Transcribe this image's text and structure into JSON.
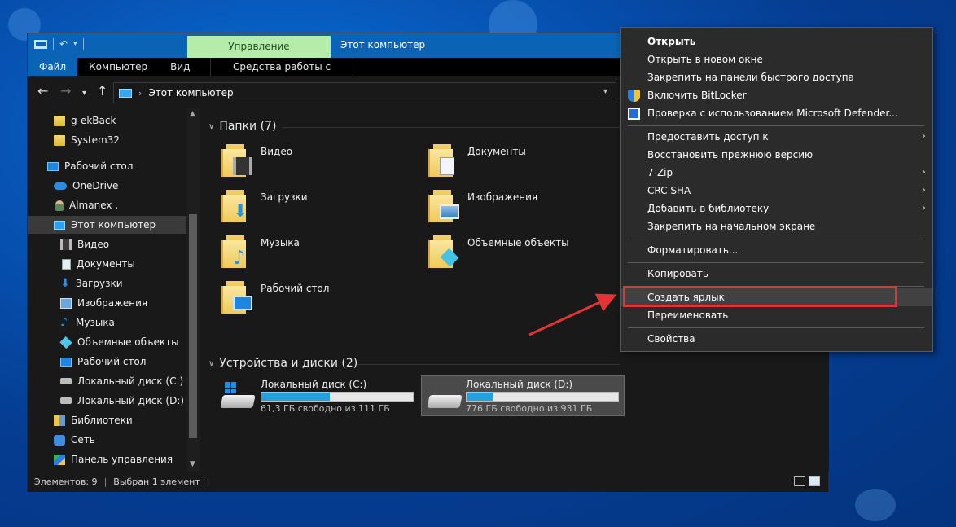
{
  "titlebar": {
    "manage_tab": "Управление",
    "window_title": "Этот компьютер"
  },
  "ribbon": {
    "tabs": [
      "Файл",
      "Компьютер",
      "Вид"
    ],
    "manage_subtab": "Средства работы с дисками"
  },
  "address": {
    "crumb": "Этот компьютер"
  },
  "sidebar": {
    "items": [
      {
        "label": "g-ekBack",
        "icon": "folder-icon"
      },
      {
        "label": "System32",
        "icon": "folder-icon"
      },
      {
        "label": "Рабочий стол",
        "icon": "desktop-icon"
      },
      {
        "label": "OneDrive",
        "icon": "cloud-icon"
      },
      {
        "label": "Almanex .",
        "icon": "user-icon"
      },
      {
        "label": "Этот компьютер",
        "icon": "computer-icon",
        "selected": true
      },
      {
        "label": "Видео",
        "icon": "video-icon"
      },
      {
        "label": "Документы",
        "icon": "documents-icon"
      },
      {
        "label": "Загрузки",
        "icon": "downloads-icon"
      },
      {
        "label": "Изображения",
        "icon": "pictures-icon"
      },
      {
        "label": "Музыка",
        "icon": "music-icon"
      },
      {
        "label": "Объемные объекты",
        "icon": "3d-objects-icon"
      },
      {
        "label": "Рабочий стол",
        "icon": "desktop-icon"
      },
      {
        "label": "Локальный диск (C:)",
        "icon": "drive-icon"
      },
      {
        "label": "Локальный диск (D:)",
        "icon": "drive-icon"
      },
      {
        "label": "Библиотеки",
        "icon": "libraries-icon"
      },
      {
        "label": "Сеть",
        "icon": "network-icon"
      },
      {
        "label": "Панель управления",
        "icon": "control-panel-icon"
      }
    ]
  },
  "content": {
    "folders_header": "Папки (7)",
    "folders": [
      "Видео",
      "Документы",
      "Загрузки",
      "Изображения",
      "Музыка",
      "Объемные объекты",
      "Рабочий стол"
    ],
    "drives_header": "Устройства и диски (2)",
    "drives": [
      {
        "name": "Локальный диск (C:)",
        "free": "61,3 ГБ свободно из 111 ГБ",
        "used_fraction": 0.45
      },
      {
        "name": "Локальный диск (D:)",
        "free": "776 ГБ свободно из 931 ГБ",
        "used_fraction": 0.17
      }
    ]
  },
  "status": {
    "items": "Элементов: 9",
    "selected": "Выбран 1 элемент"
  },
  "context_menu": {
    "items": [
      {
        "label": "Открыть",
        "bold": true
      },
      {
        "label": "Открыть в новом окне"
      },
      {
        "label": "Закрепить на панели быстрого доступа"
      },
      {
        "label": "Включить BitLocker",
        "icon": "bitlocker-shield-icon"
      },
      {
        "label": "Проверка с использованием Microsoft Defender...",
        "icon": "defender-icon"
      },
      {
        "label": "Предоставить доступ к",
        "submenu": true
      },
      {
        "label": "Восстановить прежнюю версию"
      },
      {
        "label": "7-Zip",
        "submenu": true
      },
      {
        "label": "CRC SHA",
        "submenu": true
      },
      {
        "label": "Добавить в библиотеку",
        "submenu": true
      },
      {
        "label": "Закрепить на начальном экране"
      },
      {
        "label": "Форматировать..."
      },
      {
        "label": "Копировать"
      },
      {
        "label": "Создать ярлык",
        "highlighted": true
      },
      {
        "label": "Переименовать"
      },
      {
        "label": "Свойства"
      }
    ]
  },
  "colors": {
    "accent": "#0a63b4",
    "manage_tab": "#b6ecaa",
    "annotation": "#e23434",
    "drive_bar": "#26a0da"
  }
}
